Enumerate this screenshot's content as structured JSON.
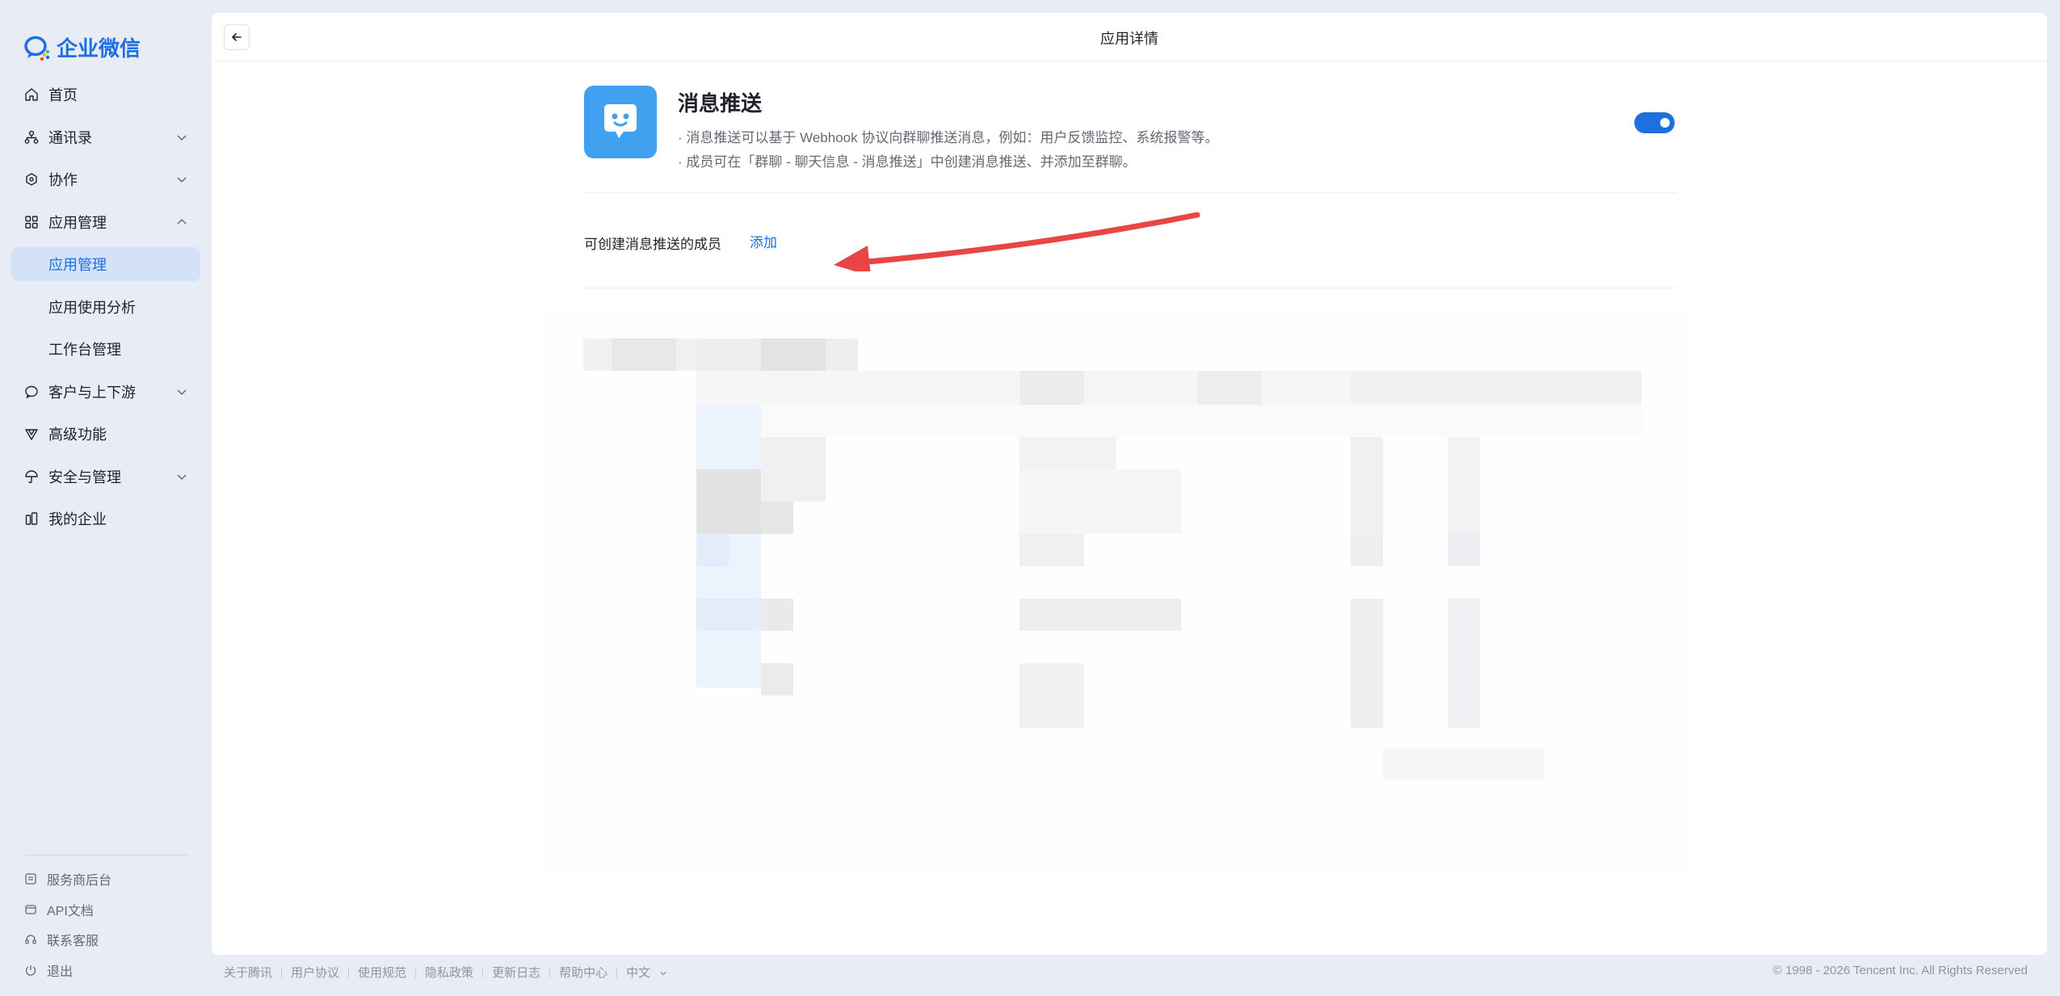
{
  "brand": {
    "name": "企业微信",
    "accent": "#1e6fe0"
  },
  "sidebar": {
    "items": [
      {
        "label": "首页",
        "icon": "home-icon"
      },
      {
        "label": "通讯录",
        "icon": "org-icon",
        "chevron": "down"
      },
      {
        "label": "协作",
        "icon": "collab-icon",
        "chevron": "down"
      },
      {
        "label": "应用管理",
        "icon": "apps-icon",
        "chevron": "up"
      },
      {
        "label": "应用管理",
        "sub": true,
        "active": true
      },
      {
        "label": "应用使用分析",
        "sub": true
      },
      {
        "label": "工作台管理",
        "sub": true
      },
      {
        "label": "客户与上下游",
        "icon": "chat-icon",
        "chevron": "down"
      },
      {
        "label": "高级功能",
        "icon": "advanced-icon"
      },
      {
        "label": "安全与管理",
        "icon": "umbrella-icon",
        "chevron": "down"
      },
      {
        "label": "我的企业",
        "icon": "building-icon"
      }
    ],
    "bottom": [
      {
        "label": "服务商后台",
        "icon": "service-icon"
      },
      {
        "label": "API文档",
        "icon": "api-icon"
      },
      {
        "label": "联系客服",
        "icon": "headset-icon"
      },
      {
        "label": "退出",
        "icon": "power-icon"
      }
    ]
  },
  "header": {
    "title": "应用详情"
  },
  "app": {
    "name": "消息推送",
    "desc1": "· 消息推送可以基于 Webhook 协议向群聊推送消息，例如：用户反馈监控、系统报警等。",
    "desc2": "· 成员可在「群聊 - 聊天信息 - 消息推送」中创建消息推送、并添加至群聊。",
    "enabled": true,
    "icon": "chat-bubble-icon"
  },
  "members": {
    "label": "可创建消息推送的成员",
    "add": "添加"
  },
  "footer": {
    "links": [
      "关于腾讯",
      "用户协议",
      "使用规范",
      "隐私政策",
      "更新日志",
      "帮助中心"
    ],
    "language": "中文",
    "copyright": "© 1998 - 2026 Tencent Inc. All Rights Reserved"
  }
}
